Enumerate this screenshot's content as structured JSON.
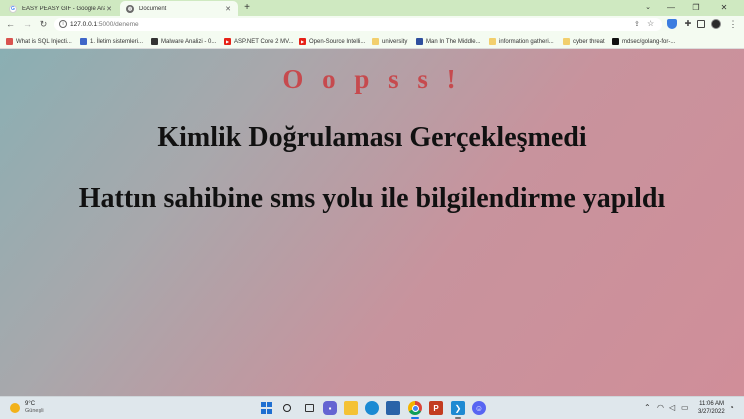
{
  "browser": {
    "tabs": [
      {
        "title": "EASY PEASY GIF - Google Arama",
        "favicon": "google-icon",
        "active": false
      },
      {
        "title": "Document",
        "favicon": "globe-icon",
        "active": true
      }
    ],
    "new_tab": "+",
    "address": {
      "host": "127.0.0.1",
      "path": ":5000/deneme"
    },
    "bookmarks": [
      {
        "label": "What is SQL Injecti...",
        "icon": "red-site-icon"
      },
      {
        "label": "1. İletim sistemleri...",
        "icon": "site-icon"
      },
      {
        "label": "Malware Analizi - 0...",
        "icon": "dark-site-icon"
      },
      {
        "label": "ASP.NET Core 2 MV...",
        "icon": "youtube-icon"
      },
      {
        "label": "Open-Source Intelli...",
        "icon": "youtube-icon"
      },
      {
        "label": "university",
        "icon": "folder-icon"
      },
      {
        "label": "Man In The Middle...",
        "icon": "site-icon"
      },
      {
        "label": "information gatheri...",
        "icon": "folder-icon"
      },
      {
        "label": "cyber threat",
        "icon": "folder-icon"
      },
      {
        "label": "mdsec/golang-for-...",
        "icon": "github-icon"
      }
    ]
  },
  "page": {
    "oops": "O o p s s !",
    "line1": "Kimlik Doğrulaması Gerçekleşmedi",
    "line2": "Hattın sahibine sms yolu ile bilgilendirme yapıldı",
    "accent_color": "#c64a4e"
  },
  "taskbar": {
    "weather_temp": "9°C",
    "weather_desc": "Güneşli",
    "time": "11:06 AM",
    "date": "3/27/2022"
  }
}
